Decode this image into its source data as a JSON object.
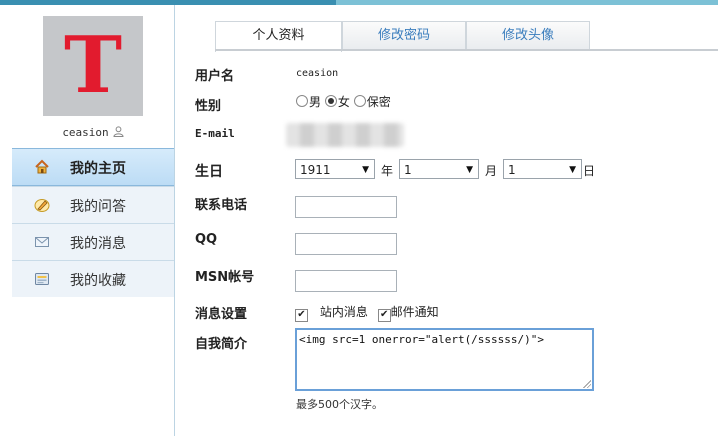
{
  "user": {
    "username": "ceasion"
  },
  "sidebar": {
    "items": [
      {
        "label": "我的主页",
        "icon": "home-icon",
        "active": true
      },
      {
        "label": "我的问答",
        "icon": "pencil-icon",
        "active": false
      },
      {
        "label": "我的消息",
        "icon": "envelope-icon",
        "active": false
      },
      {
        "label": "我的收藏",
        "icon": "folder-icon",
        "active": false
      }
    ]
  },
  "tabs": [
    {
      "label": "个人资料",
      "active": true
    },
    {
      "label": "修改密码",
      "active": false
    },
    {
      "label": "修改头像",
      "active": false
    }
  ],
  "form": {
    "username_label": "用户名",
    "username_value": "ceasion",
    "gender_label": "性别",
    "gender_options": [
      "男",
      "女",
      "保密"
    ],
    "gender_selected": "女",
    "email_label": "E-mail",
    "birthday_label": "生日",
    "birth_year": "1911",
    "year_unit": "年",
    "birth_month": "1",
    "month_unit": "月",
    "birth_day": "1",
    "day_unit": "日",
    "phone_label": "联系电话",
    "qq_label": "QQ",
    "msn_label": "MSN帐号",
    "notify_label": "消息设置",
    "notify_site": "站内消息",
    "notify_mail": "邮件通知",
    "bio_label": "自我简介",
    "bio_value": "<img src=1 onerror=\"alert(/ssssss/)\">",
    "bio_hint": "最多500个汉字。"
  },
  "colors": {
    "accent": "#3a8fb1",
    "avatar_letter": "#e21b2e",
    "tab_text": "#3a7dbd"
  }
}
